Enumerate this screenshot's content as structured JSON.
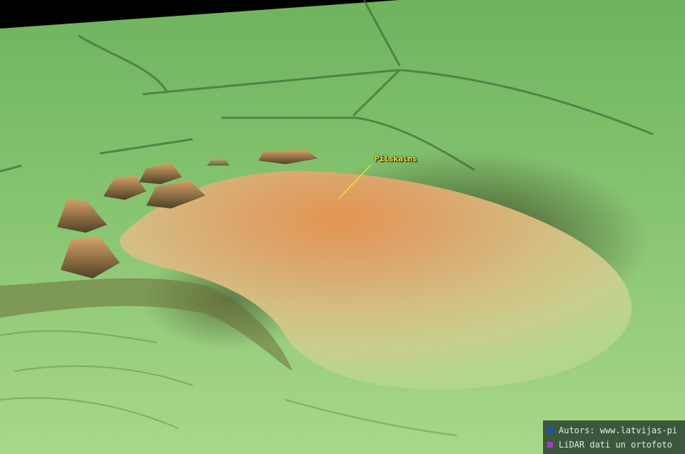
{
  "map": {
    "feature_label": "Pilskalns"
  },
  "credits": [
    {
      "text": "Autors: www.latvijas-pi",
      "color": "#1e4fb8"
    },
    {
      "text": "LiDAR dati un ortofoto",
      "color": "#9a3fc8"
    }
  ],
  "colors": {
    "label": "#ffe838",
    "terrain_low": "#a9d889",
    "terrain_mid": "#7fbf6a",
    "hill_top": "#e29a58",
    "hill_shadow": "#3b3a22"
  }
}
